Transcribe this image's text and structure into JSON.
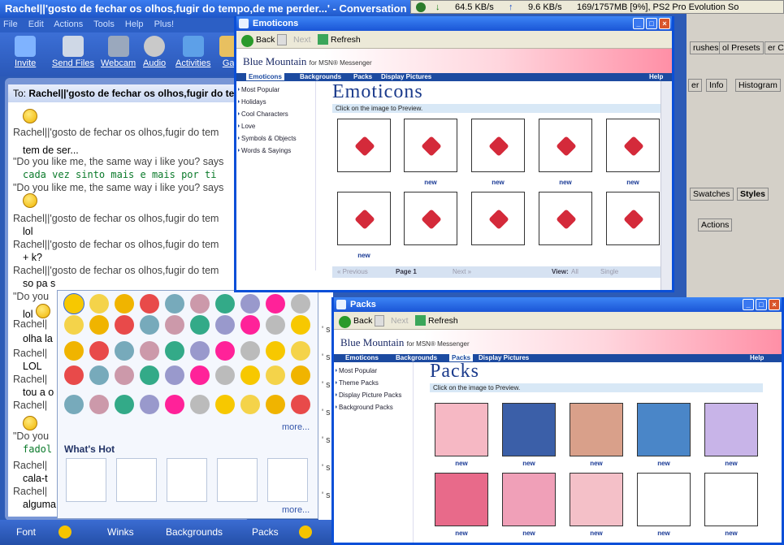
{
  "messenger": {
    "title": "Rachel||'gosto de fechar os olhos,fugir do tempo,de me perder...' - Conversation",
    "menu": [
      "File",
      "Edit",
      "Actions",
      "Tools",
      "Help",
      "Plus!"
    ],
    "toolbar": [
      "Invite",
      "Send Files",
      "Webcam",
      "Audio",
      "Activities",
      "Gar"
    ],
    "to_label": "To:",
    "to_name": "Rachel||'gosto de fechar os olhos,fugir do tempo,de me",
    "chat": [
      {
        "t": "name",
        "text": "Rachel||'gosto de fechar os olhos,fugir do tem"
      },
      {
        "t": "msg",
        "text": "tem de ser..."
      },
      {
        "t": "name",
        "text": "\"Do you like me, the same way i like you? says"
      },
      {
        "t": "green",
        "text": "cada vez sinto mais e mais por ti"
      },
      {
        "t": "name",
        "text": "\"Do you like me, the same way i like you? says"
      },
      {
        "t": "name",
        "text": "Rachel||'gosto de fechar os olhos,fugir do tem"
      },
      {
        "t": "msg",
        "text": "lol"
      },
      {
        "t": "name",
        "text": "Rachel||'gosto de fechar os olhos,fugir do tem"
      },
      {
        "t": "msg",
        "text": "+ k?"
      },
      {
        "t": "name",
        "text": "Rachel||'gosto de fechar os olhos,fugir do tem"
      },
      {
        "t": "msg",
        "text": "so pa s"
      },
      {
        "t": "name",
        "text": "\"Do you"
      },
      {
        "t": "msg",
        "text": "lol"
      },
      {
        "t": "name",
        "text": "Rachel|"
      },
      {
        "t": "msg",
        "text": "olha la"
      },
      {
        "t": "name",
        "text": "Rachel|"
      },
      {
        "t": "msg",
        "text": "LOL"
      },
      {
        "t": "name",
        "text": "Rachel|"
      },
      {
        "t": "msg",
        "text": "tou a o"
      },
      {
        "t": "name",
        "text": "Rachel|"
      },
      {
        "t": "name",
        "text": "\"Do you"
      },
      {
        "t": "green",
        "text": "fadol"
      },
      {
        "t": "name",
        "text": "Rachel|"
      },
      {
        "t": "msg",
        "text": "cala-t"
      },
      {
        "t": "name",
        "text": "Rachel|"
      },
      {
        "t": "msg",
        "text": "alguma"
      }
    ],
    "side_marks": [
      "' s",
      "' s",
      "' s",
      "' s",
      "' s",
      "' s",
      "' s",
      "' s"
    ],
    "picker": {
      "more": "more...",
      "more2": "more...",
      "whats_hot": "What's Hot"
    },
    "bottom": [
      "Font",
      "Winks",
      "Backgrounds",
      "Packs"
    ]
  },
  "tray": {
    "down": "64.5 KB/s",
    "up": "9.6 KB/s",
    "mem": "169/1757MB [9%], PS2 Pro Evolution So"
  },
  "photoshop": {
    "tabs": [
      "rushes",
      "ol Presets",
      "er C",
      "er",
      "Info",
      "Histogram",
      "Swatches",
      "Styles",
      "Actions"
    ]
  },
  "colors": {
    "xp_blue": "#0a4fd8",
    "bm_nav": "#1c4aa0",
    "title_blue": "#1b3b8c"
  },
  "emoticons_win": {
    "title": "Emoticons",
    "back": "Back",
    "next": "Next",
    "refresh": "Refresh",
    "logo": "Blue Mountain",
    "logo_sub": "for MSN® Messenger",
    "nav": [
      "Emoticons",
      "Backgrounds",
      "Packs",
      "Display Pictures"
    ],
    "help": "Help",
    "side": [
      "Most Popular",
      "Holidays",
      "Cool Characters",
      "Love",
      "Symbols & Objects",
      "Words & Sayings"
    ],
    "heading": "Emoticons",
    "click": "Click on the image to Preview.",
    "new_labels": [
      "new",
      "new",
      "new",
      "new",
      "new"
    ],
    "pager": {
      "prev": "« Previous",
      "page": "Page 1",
      "next": "Next »",
      "view": "View:",
      "all": "All",
      "single": "Single"
    }
  },
  "packs_win": {
    "title": "Packs",
    "back": "Back",
    "next": "Next",
    "refresh": "Refresh",
    "logo": "Blue Mountain",
    "logo_sub": "for MSN® Messenger",
    "nav": [
      "Emoticons",
      "Backgrounds",
      "Packs",
      "Display Pictures"
    ],
    "help": "Help",
    "side": [
      "Most Popular",
      "Theme Packs",
      "Display Picture Packs",
      "Background Packs"
    ],
    "heading": "Packs",
    "click": "Click on the image to Preview.",
    "new_labels": [
      "new",
      "new",
      "new",
      "new",
      "new",
      "new",
      "new",
      "new",
      "new",
      "new"
    ]
  }
}
